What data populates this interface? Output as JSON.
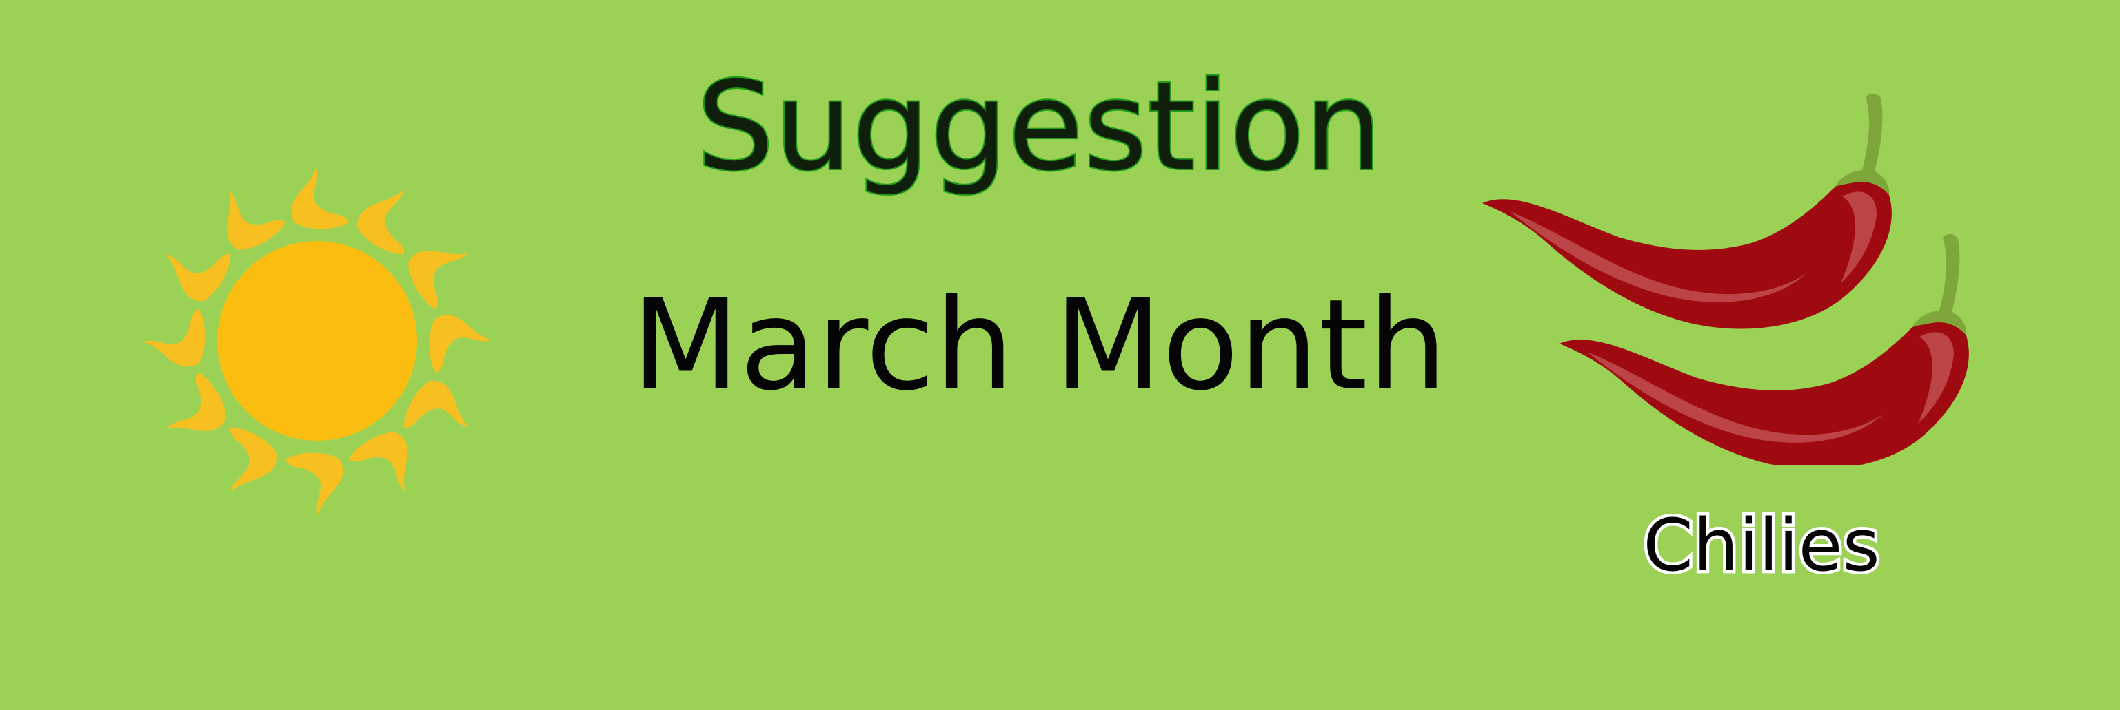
{
  "banner": {
    "title": "Suggestion",
    "subtitle": "March Month",
    "caption": "Chilies"
  },
  "icons": {
    "sun": "sun-icon",
    "chili": "chili-pepper-icon"
  },
  "colors": {
    "background": "#9bd154",
    "title_fill": "#0f1f0b",
    "title_outline": "#1f9d1a",
    "text": "#050505",
    "caption_outline": "#ffffff",
    "sun": "#fbbe10",
    "sun_rays": "#f7c020",
    "chili": "#9e0a10",
    "chili_highlight": "#c65858",
    "chili_stem": "#7fa63a"
  }
}
